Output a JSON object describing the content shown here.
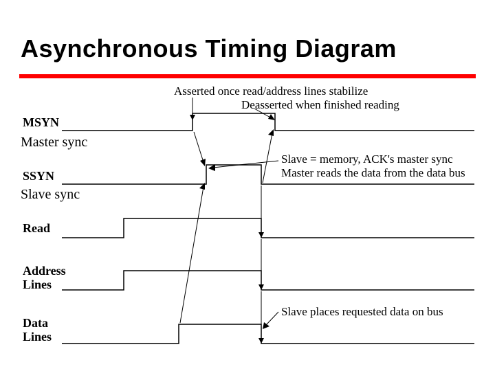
{
  "title": "Asynchronous Timing Diagram",
  "notes": {
    "asserted": "Asserted once read/address lines stabilize",
    "deasserted": "Deasserted when finished reading",
    "slave_ack_1": "Slave = memory, ACK's master sync",
    "slave_ack_2": "Master reads the data from the data bus",
    "data_on_bus": "Slave places requested data on bus"
  },
  "side_labels": {
    "master_sync": "Master sync",
    "slave_sync": "Slave sync"
  },
  "signals": {
    "msyn": "MSYN",
    "ssyn": "SSYN",
    "read": "Read",
    "address": "Address\nLines",
    "data": "Data\nLines"
  }
}
